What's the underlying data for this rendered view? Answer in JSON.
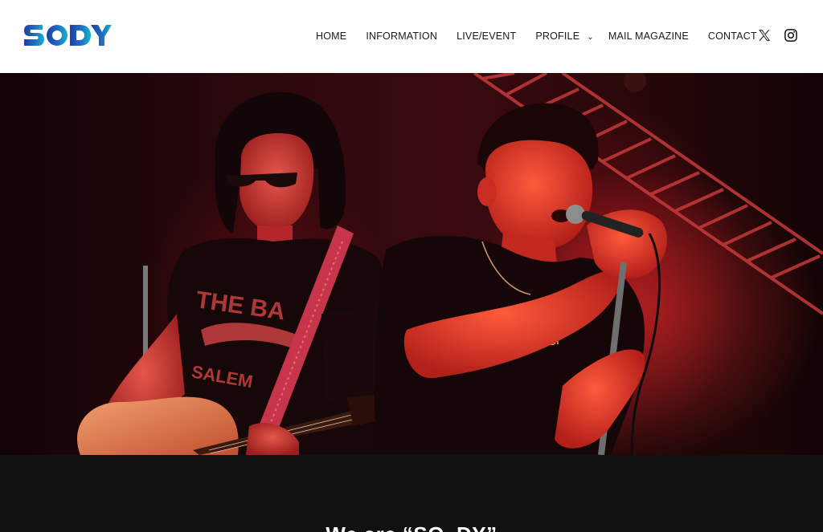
{
  "brand": {
    "logo_text": "SODY",
    "colors": {
      "primary": "#1e4fae",
      "accent": "#18a8c8"
    }
  },
  "nav": {
    "items": [
      {
        "label": "HOME"
      },
      {
        "label": "INFORMATION"
      },
      {
        "label": "LIVE/EVENT"
      },
      {
        "label": "PROFILE",
        "has_submenu": true
      },
      {
        "label": "MAIL MAGAZINE"
      },
      {
        "label": "CONTACT"
      }
    ],
    "submenu_icon": "chevron-down-icon",
    "chevron_glyph": "⌄"
  },
  "social": [
    {
      "icon": "x-twitter-icon"
    },
    {
      "icon": "instagram-icon"
    }
  ],
  "hero": {
    "description": "Two musicians performing on stage under red lights: a guitarist with an acoustic guitar on the left and a vocalist singing into a microphone on the right, with lighting truss overhead."
  },
  "section": {
    "heading": "We are “SO_DY”"
  }
}
